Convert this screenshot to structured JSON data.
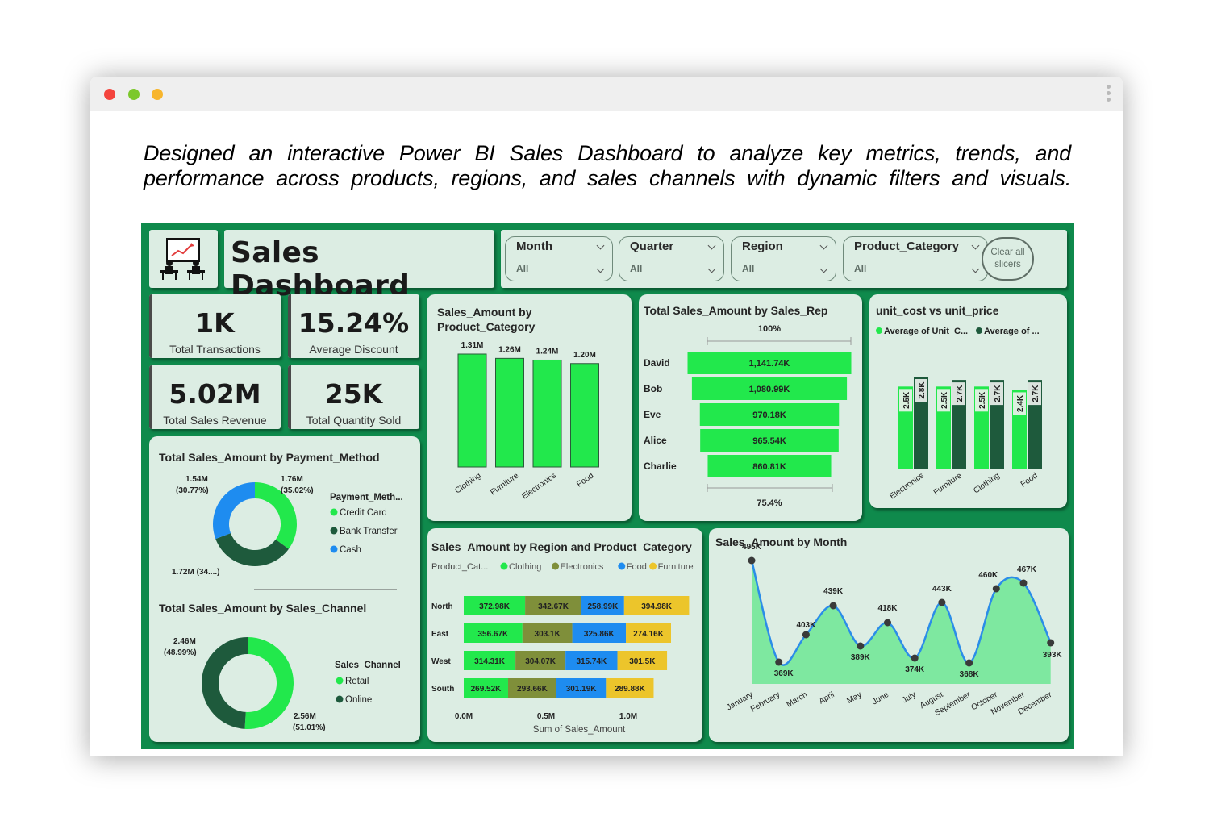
{
  "headline": {
    "line1": "Designed an interactive Power BI Sales Dashboard to analyze key metrics, trends, and",
    "line2": "performance across products, regions, and sales channels with dynamic filters and visuals."
  },
  "dashboard": {
    "title": "Sales Dashboard",
    "slicers": [
      {
        "label": "Month",
        "value": "All"
      },
      {
        "label": "Quarter",
        "value": "All"
      },
      {
        "label": "Region",
        "value": "All"
      },
      {
        "label": "Product_Category",
        "value": "All"
      }
    ],
    "clear_label_1": "Clear all",
    "clear_label_2": "slicers",
    "kpis": [
      {
        "value": "1K",
        "label": "Total Transactions"
      },
      {
        "value": "15.24%",
        "label": "Average Discount"
      },
      {
        "value": "5.02M",
        "label": "Total Sales Revenue"
      },
      {
        "value": "25K",
        "label": "Total Quantity Sold"
      }
    ]
  },
  "colors": {
    "dashboard_bg": "#0f8a4c",
    "card_bg": "#dcede3",
    "bright_green": "#22e84c",
    "dark_green": "#1e5a3c",
    "blue": "#1e8cf0",
    "olive": "#7f8f3a",
    "yellow": "#ecc52b"
  },
  "chart_data": [
    {
      "id": "category",
      "type": "bar",
      "title": "Sales_Amount by Product_Category",
      "categories": [
        "Clothing",
        "Furniture",
        "Electronics",
        "Food"
      ],
      "values": [
        1.31,
        1.26,
        1.24,
        1.2
      ],
      "labels": [
        "1.31M",
        "1.26M",
        "1.24M",
        "1.20M"
      ]
    },
    {
      "id": "rep",
      "type": "bar",
      "title": "Total Sales_Amount by Sales_Rep",
      "top_label": "100%",
      "bottom_label": "75.4%",
      "categories": [
        "David",
        "Bob",
        "Eve",
        "Alice",
        "Charlie"
      ],
      "values": [
        1141.74,
        1080.99,
        970.18,
        965.54,
        860.81
      ],
      "labels": [
        "1,141.74K",
        "1,080.99K",
        "970.18K",
        "965.54K",
        "860.81K"
      ]
    },
    {
      "id": "costprice",
      "type": "bar",
      "title": "unit_cost vs unit_price",
      "categories": [
        "Electronics",
        "Furniture",
        "Clothing",
        "Food"
      ],
      "series": [
        {
          "name": "Average of Unit_C...",
          "values": [
            2.5,
            2.5,
            2.5,
            2.4
          ],
          "labels": [
            "2.5K",
            "2.5K",
            "2.5K",
            "2.4K"
          ]
        },
        {
          "name": "Average of ...",
          "values": [
            2.8,
            2.7,
            2.7,
            2.7
          ],
          "labels": [
            "2.8K",
            "2.7K",
            "2.7K",
            "2.7K"
          ]
        }
      ]
    },
    {
      "id": "payment",
      "type": "pie",
      "title": "Total Sales_Amount by Payment_Method",
      "legend_title": "Payment_Meth...",
      "slices": [
        {
          "name": "Credit Card",
          "value": 1.76,
          "label": "1.76M",
          "pct": "(35.02%)"
        },
        {
          "name": "Bank Transfer",
          "value": 1.72,
          "label": "1.72M (34....)",
          "pct": ""
        },
        {
          "name": "Cash",
          "value": 1.54,
          "label": "1.54M",
          "pct": "(30.77%)"
        }
      ]
    },
    {
      "id": "channel",
      "type": "pie",
      "title": "Total Sales_Amount by Sales_Channel",
      "legend_title": "Sales_Channel",
      "slices": [
        {
          "name": "Retail",
          "value": 2.56,
          "label": "2.56M",
          "pct": "(51.01%)"
        },
        {
          "name": "Online",
          "value": 2.46,
          "label": "2.46M",
          "pct": "(48.99%)"
        }
      ]
    },
    {
      "id": "region",
      "type": "bar",
      "title": "Sales_Amount by Region and Product_Category",
      "legend_title": "Product_Cat...",
      "xlabel": "Sum of Sales_Amount",
      "xticks": [
        "0.0M",
        "0.5M",
        "1.0M"
      ],
      "xlim": [
        0,
        1.0
      ],
      "categories": [
        "North",
        "East",
        "West",
        "South"
      ],
      "series": [
        {
          "name": "Clothing",
          "values": [
            372.98,
            356.67,
            314.31,
            269.52
          ],
          "labels": [
            "372.98K",
            "356.67K",
            "314.31K",
            "269.52K"
          ]
        },
        {
          "name": "Electronics",
          "values": [
            342.67,
            303.1,
            304.07,
            293.66
          ],
          "labels": [
            "342.67K",
            "303.1K",
            "304.07K",
            "293.66K"
          ]
        },
        {
          "name": "Food",
          "values": [
            258.99,
            325.86,
            315.74,
            301.19
          ],
          "labels": [
            "258.99K",
            "325.86K",
            "315.74K",
            "301.19K"
          ]
        },
        {
          "name": "Furniture",
          "values": [
            394.98,
            274.16,
            301.5,
            289.88
          ],
          "labels": [
            "394.98K",
            "274.16K",
            "301.5K",
            "289.88K"
          ]
        }
      ]
    },
    {
      "id": "month",
      "type": "area",
      "title": "Sales_Amount by Month",
      "categories": [
        "January",
        "February",
        "March",
        "April",
        "May",
        "June",
        "July",
        "August",
        "September",
        "October",
        "November",
        "December"
      ],
      "values": [
        495,
        369,
        403,
        439,
        389,
        418,
        374,
        443,
        368,
        460,
        467,
        393
      ],
      "labels": [
        "495K",
        "369K",
        "403K",
        "439K",
        "389K",
        "418K",
        "374K",
        "443K",
        "368K",
        "460K",
        "467K",
        "393K"
      ]
    }
  ]
}
